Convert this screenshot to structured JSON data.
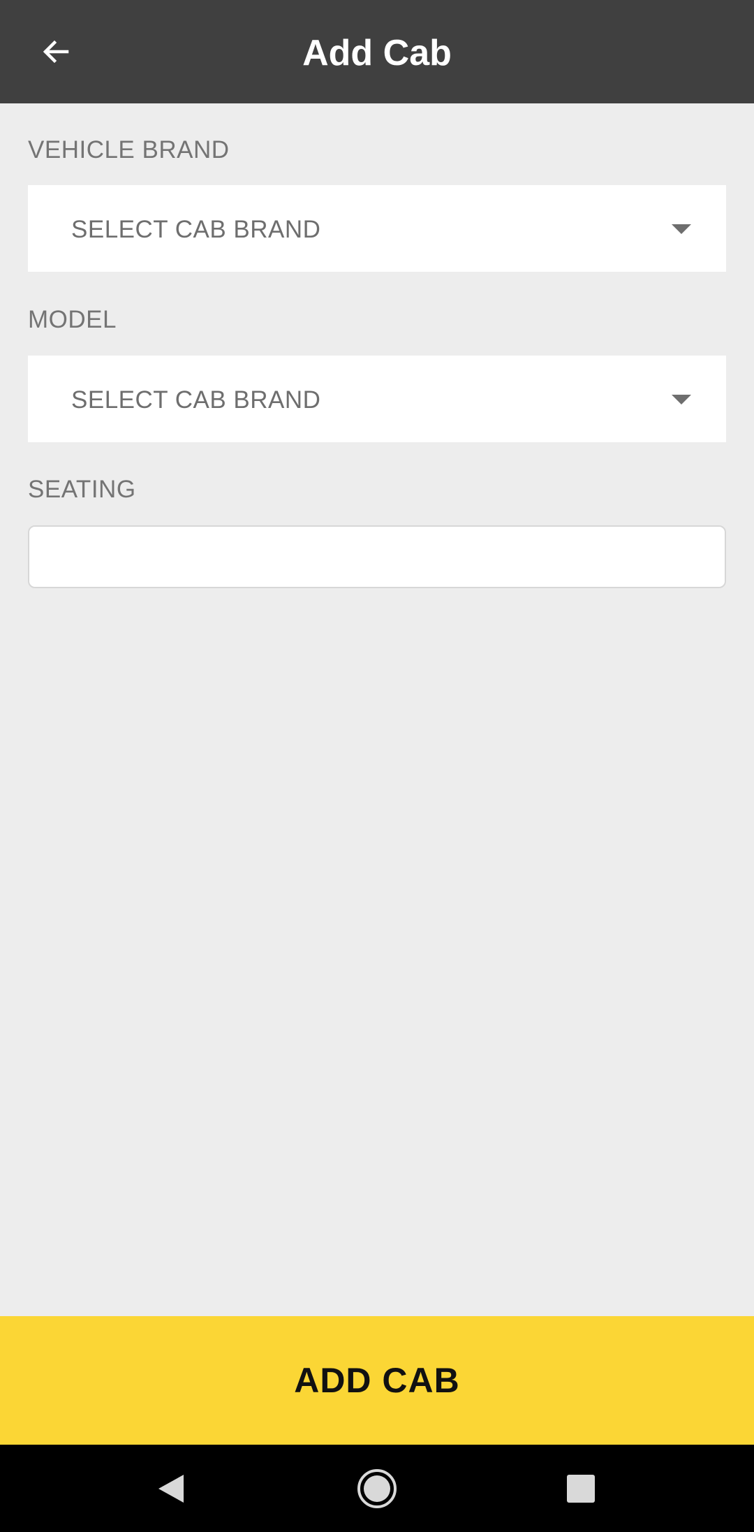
{
  "app_bar": {
    "title": "Add Cab",
    "back_icon": "arrow-left-icon",
    "background": "#404040"
  },
  "form": {
    "vehicle_brand": {
      "label": "VEHICLE BRAND",
      "selected_value": "SELECT CAB BRAND",
      "icon": "caret-down-icon"
    },
    "model": {
      "label": "MODEL",
      "selected_value": "SELECT CAB BRAND",
      "icon": "caret-down-icon"
    },
    "seating": {
      "label": "SEATING",
      "value": ""
    }
  },
  "primary_action": {
    "label": "ADD CAB",
    "color": "#fbd635"
  },
  "system_nav": {
    "back_icon": "triangle-back-icon",
    "home_icon": "circle-home-icon",
    "recents_icon": "square-recents-icon"
  }
}
